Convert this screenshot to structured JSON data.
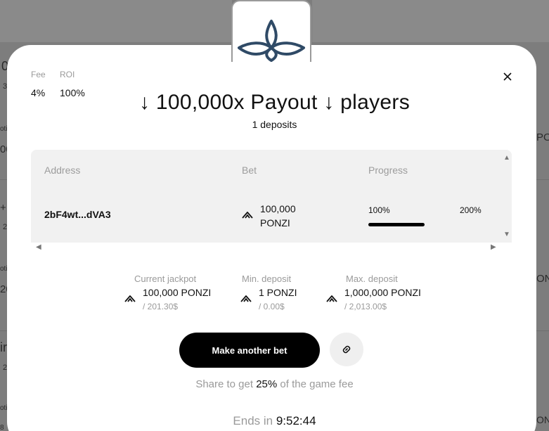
{
  "background": {
    "frag_left": [
      "0",
      "3",
      "oti",
      "00",
      "+",
      "2",
      "oti",
      "20",
      "ir",
      "2",
      "oti",
      "8"
    ],
    "frag_right": [
      "PO",
      "ONZ",
      "ONZI"
    ]
  },
  "stats": {
    "fee_label": "Fee",
    "fee_value": "4%",
    "roi_label": "ROI",
    "roi_value": "100%"
  },
  "header": {
    "title": "↓ 100,000x Payout ↓ players",
    "subtitle": "1 deposits"
  },
  "table": {
    "columns": [
      "Address",
      "Bet",
      "Progress"
    ],
    "rows": [
      {
        "address": "2bF4wt...dVA3",
        "bet_amount": "100,000",
        "bet_unit": "PONZI",
        "progress_start": "100%",
        "progress_end": "200%",
        "progress_fraction": 1.0
      }
    ]
  },
  "meta": {
    "jackpot_label": "Current jackpot",
    "jackpot_value": "100,000 PONZI",
    "jackpot_usd": "/ 201.30$",
    "min_label": "Min. deposit",
    "min_value": "1 PONZI",
    "min_usd": "/ 0.00$",
    "max_label": "Max. deposit",
    "max_value": "1,000,000 PONZI",
    "max_usd": "/ 2,013.00$"
  },
  "actions": {
    "bet_button": "Make another bet"
  },
  "share": {
    "prefix": "Share to get",
    "percent": "25%",
    "suffix": "of the game fee"
  },
  "timer": {
    "label": "Ends in",
    "value": "9:52:44"
  },
  "icons": {
    "logo": "ponzi-logo-icon",
    "close": "close-icon",
    "link": "link-icon",
    "token": "ponzi-token-icon"
  },
  "colors": {
    "brand": "#2f4a66",
    "accent": "#000000",
    "muted": "#9a9a9a"
  }
}
